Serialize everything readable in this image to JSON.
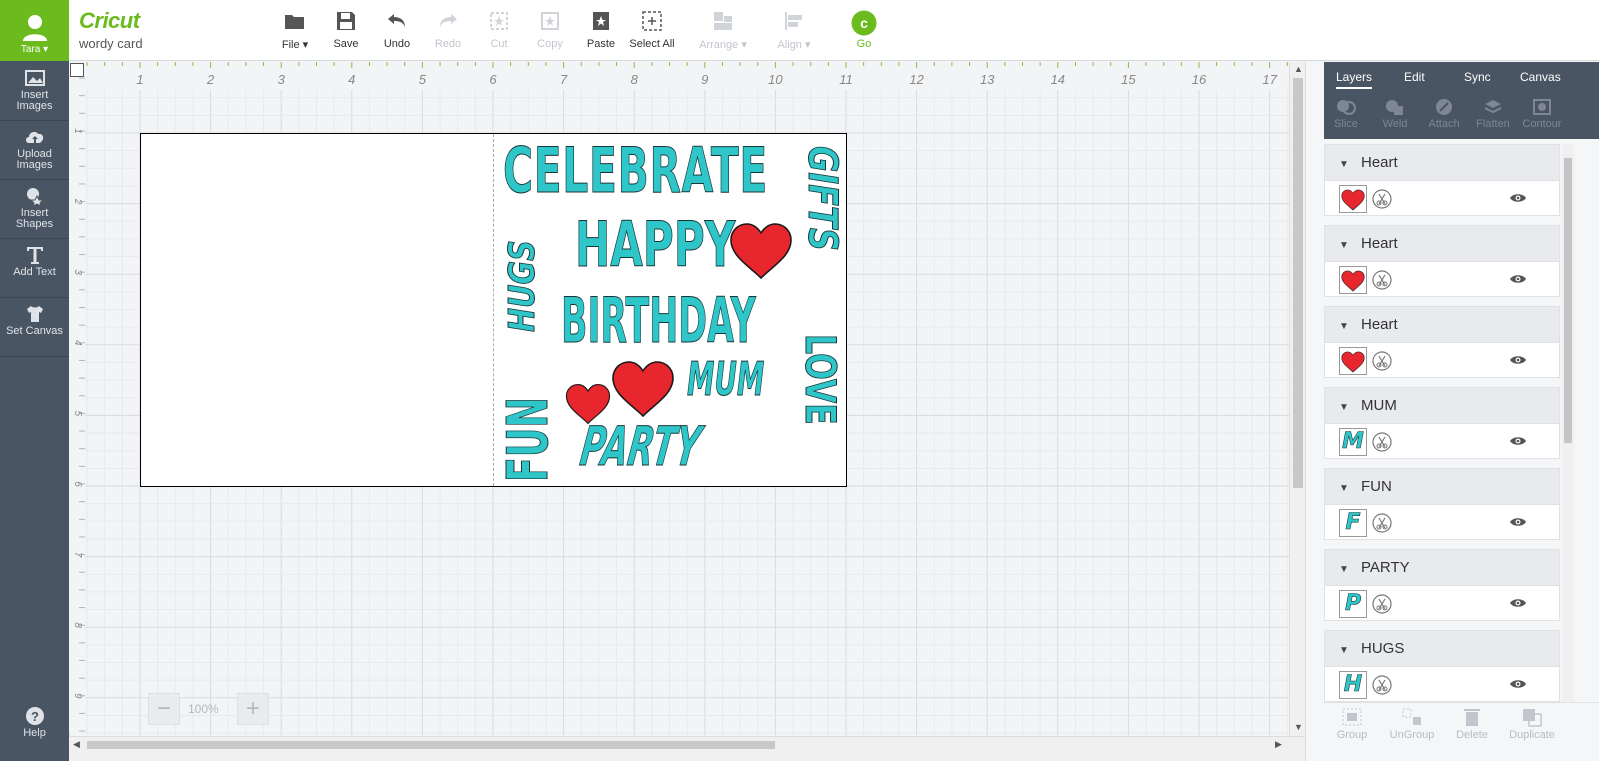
{
  "user": {
    "name": "Tara"
  },
  "brand": {
    "logo": "Cricut",
    "project_name": "wordy card"
  },
  "sidebar": {
    "items": [
      {
        "label_1": "Insert",
        "label_2": "Images",
        "icon": "image-icon"
      },
      {
        "label_1": "Upload",
        "label_2": "Images",
        "icon": "upload-icon"
      },
      {
        "label_1": "Insert",
        "label_2": "Shapes",
        "icon": "shapes-icon"
      },
      {
        "label_1": "Add Text",
        "label_2": "",
        "icon": "text-icon"
      },
      {
        "label_1": "Set Canvas",
        "label_2": "",
        "icon": "shirt-icon"
      }
    ],
    "help_label": "Help"
  },
  "toolbar": {
    "file": "File",
    "save": "Save",
    "undo": "Undo",
    "redo": "Redo",
    "cut": "Cut",
    "copy": "Copy",
    "paste": "Paste",
    "select_all": "Select All",
    "arrange": "Arrange",
    "align": "Align",
    "go": "Go"
  },
  "ruler": {
    "top": [
      "1",
      "2",
      "3",
      "4",
      "5",
      "6",
      "7",
      "8",
      "9",
      "10",
      "11",
      "12",
      "13",
      "14",
      "15",
      "16",
      "17"
    ],
    "left": [
      "1",
      "2",
      "3",
      "4",
      "5",
      "6",
      "7",
      "8",
      "9"
    ]
  },
  "zoom": {
    "value": "100%"
  },
  "card": {
    "words": {
      "celebrate": "CELEBRATE",
      "happy": "HAPPY",
      "birthday": "BIRTHDAY",
      "hugs": "HUGS",
      "gifts": "GIFTS",
      "love": "LOVE",
      "fun": "FUN",
      "mum": "MUM",
      "party": "PARTY"
    }
  },
  "panel": {
    "tabs": [
      "Layers",
      "Edit",
      "Sync",
      "Canvas"
    ],
    "actions": [
      "Slice",
      "Weld",
      "Attach",
      "Flatten",
      "Contour"
    ],
    "layers": [
      {
        "name": "Heart",
        "thumb": "heart"
      },
      {
        "name": "Heart",
        "thumb": "heart"
      },
      {
        "name": "Heart",
        "thumb": "heart"
      },
      {
        "name": "MUM",
        "thumb": "M"
      },
      {
        "name": "FUN",
        "thumb": "F"
      },
      {
        "name": "PARTY",
        "thumb": "P"
      },
      {
        "name": "HUGS",
        "thumb": "H"
      }
    ],
    "bottom_actions": [
      "Group",
      "UnGroup",
      "Delete",
      "Duplicate"
    ]
  },
  "colors": {
    "brand_green": "#6bbb1e",
    "sidebar_gray": "#4a5563",
    "teal": "#2ec6c8",
    "heart_red": "#e8262e"
  }
}
